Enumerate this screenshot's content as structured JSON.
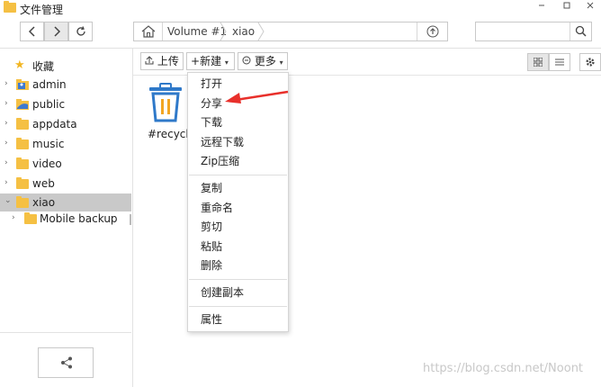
{
  "window": {
    "title": "文件管理",
    "icon": "folder-icon"
  },
  "nav": {
    "back": "back-icon",
    "forward": "forward-icon",
    "refresh": "refresh-icon"
  },
  "path": {
    "segments": [
      "Volume #1",
      "xiao"
    ]
  },
  "search": {
    "value": "",
    "placeholder": ""
  },
  "sidebar": {
    "favorites_label": "收藏",
    "items": [
      {
        "label": "admin",
        "icon": "user-folder-icon"
      },
      {
        "label": "public",
        "icon": "shared-folder-icon"
      },
      {
        "label": "appdata",
        "icon": "folder-icon"
      },
      {
        "label": "music",
        "icon": "folder-icon"
      },
      {
        "label": "video",
        "icon": "folder-icon"
      },
      {
        "label": "web",
        "icon": "folder-icon"
      },
      {
        "label": "xiao",
        "icon": "folder-icon",
        "selected": true
      },
      {
        "label": "Mobile backup",
        "icon": "folder-icon"
      }
    ]
  },
  "actions": {
    "upload": "上传",
    "new": "新建",
    "more": "更多"
  },
  "files": [
    {
      "name": "#recycle",
      "icon": "recycle-bin-icon"
    }
  ],
  "context_menu": {
    "groups": [
      [
        "打开",
        "分享",
        "下载",
        "远程下载",
        "Zip压缩"
      ],
      [
        "复制",
        "重命名",
        "剪切",
        "粘贴",
        "删除"
      ],
      [
        "创建副本"
      ],
      [
        "属性"
      ]
    ]
  },
  "annotation": {
    "arrow_color": "#e8302b"
  },
  "watermark": "https://blog.csdn.net/Noont",
  "colors": {
    "folder": "#f5c043",
    "recycle": "#2f79c9",
    "selected": "#c9c9c9"
  }
}
